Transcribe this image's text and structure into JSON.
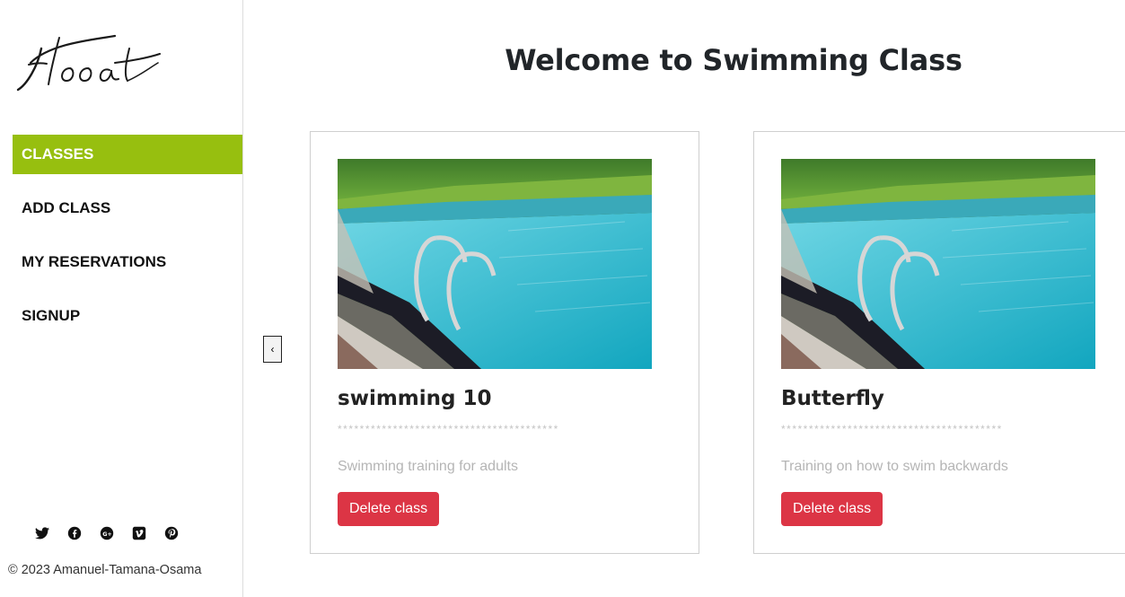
{
  "brand": {
    "logo_text": "Float"
  },
  "sidebar": {
    "items": [
      {
        "label": "CLASSES",
        "active": true
      },
      {
        "label": "ADD CLASS",
        "active": false
      },
      {
        "label": "MY RESERVATIONS",
        "active": false
      },
      {
        "label": "SIGNUP",
        "active": false
      }
    ],
    "social_icons": [
      "twitter-icon",
      "facebook-icon",
      "google-plus-icon",
      "vimeo-icon",
      "pinterest-icon"
    ],
    "footer": "© 2023 Amanuel-Tamana-Osama"
  },
  "main": {
    "title": "Welcome to Swimming Class",
    "prev_label": "‹",
    "cards": [
      {
        "name": "swimming 10",
        "stars": "****************************************",
        "description": "Swimming training for adults",
        "delete_label": "Delete class"
      },
      {
        "name": "Butterfly",
        "stars": "****************************************",
        "description": "Training on how to swim backwards",
        "delete_label": "Delete class"
      }
    ]
  },
  "colors": {
    "accent": "#97bf0f",
    "danger": "#dc3545"
  }
}
